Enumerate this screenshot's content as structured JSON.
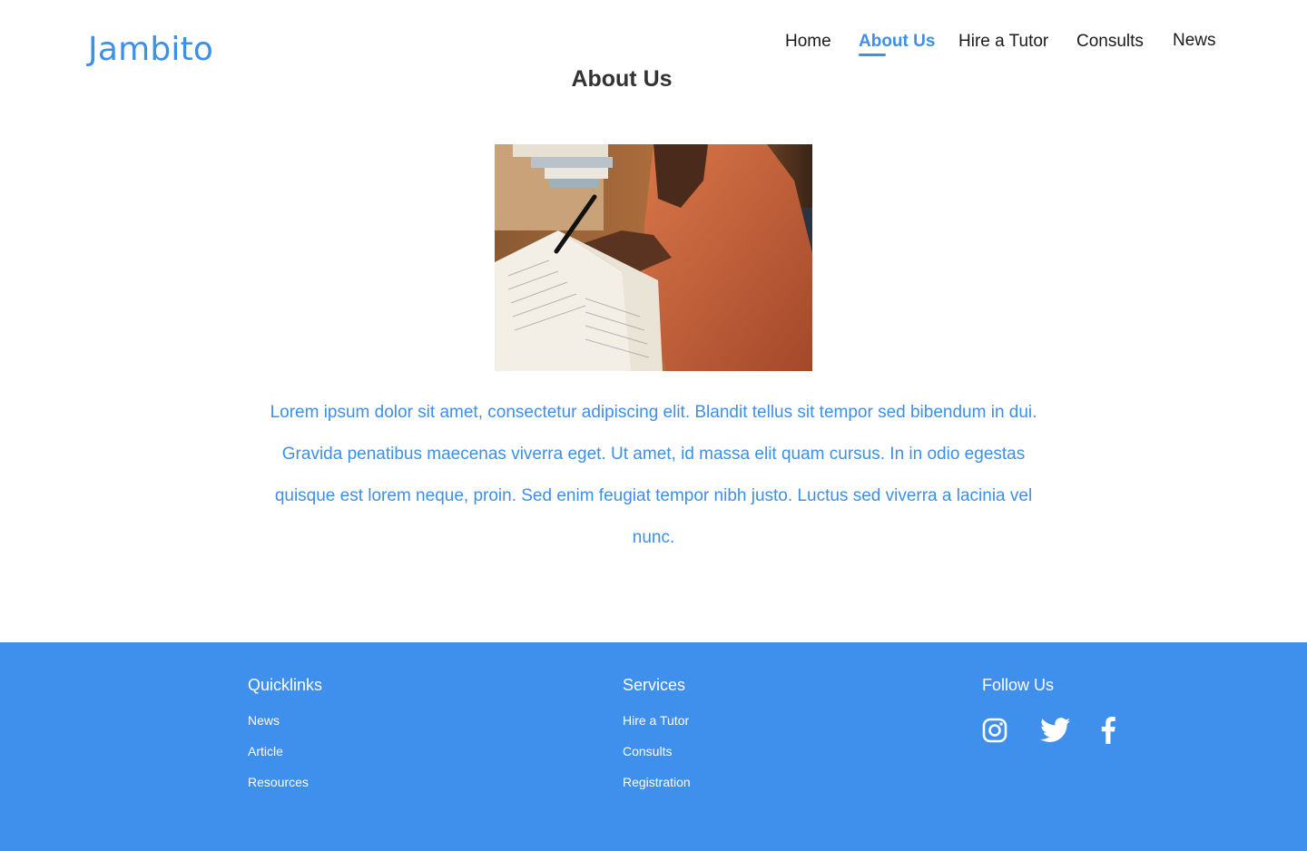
{
  "brand": {
    "name": "Jambito",
    "color": "#3d8fe8"
  },
  "nav": {
    "items": [
      {
        "label": "Home",
        "active": false
      },
      {
        "label": "About Us",
        "active": true
      },
      {
        "label": "Hire a Tutor",
        "active": false
      },
      {
        "label": "Consults",
        "active": false
      },
      {
        "label": "News",
        "active": false
      }
    ]
  },
  "main": {
    "title": "About Us",
    "image": {
      "icon": "photo-person-writing-notebook"
    },
    "body": "Lorem ipsum dolor sit amet, consectetur adipiscing elit. Blandit tellus sit tempor sed bibendum in dui. Gravida penatibus maecenas viverra eget. Ut amet, id massa elit quam cursus. In in odio egestas quisque est lorem neque, proin. Sed enim feugiat tempor nibh justo. Luctus sed viverra a lacinia vel nunc."
  },
  "footer": {
    "background": "#3f8fed",
    "quicklinks": {
      "heading": "Quicklinks",
      "links": [
        "News",
        "Article",
        "Resources"
      ]
    },
    "services": {
      "heading": "Services",
      "links": [
        "Hire a Tutor",
        "Consults",
        "Registration"
      ]
    },
    "follow": {
      "heading": "Follow Us",
      "icons": [
        "instagram-icon",
        "twitter-icon",
        "facebook-icon"
      ]
    }
  }
}
